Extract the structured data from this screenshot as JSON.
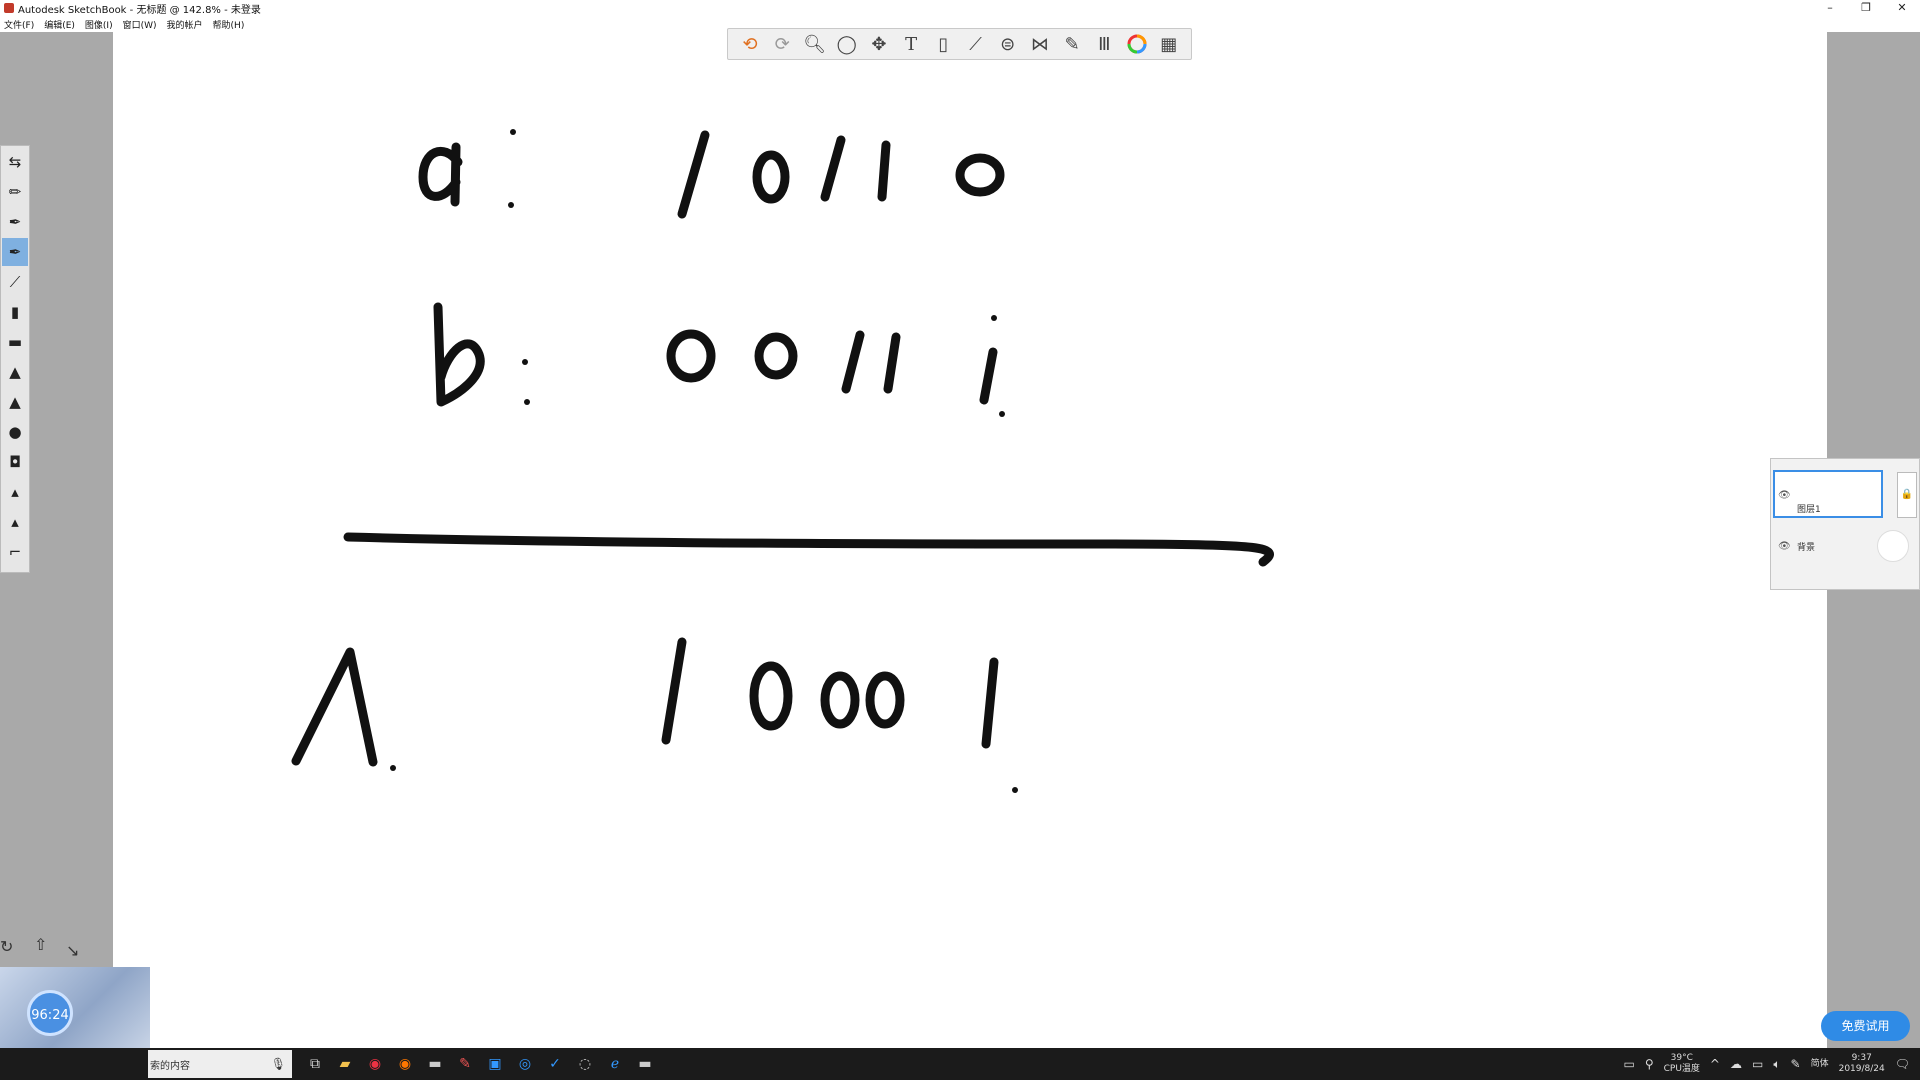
{
  "window": {
    "title": "Autodesk SketchBook - 无标题 @ 142.8% - 未登录",
    "controls": [
      "–",
      "❐",
      "✕"
    ]
  },
  "menu": [
    "文件(F)",
    "编辑(E)",
    "图像(I)",
    "窗口(W)",
    "我的帐户",
    "帮助(H)"
  ],
  "toolbar": {
    "icons": [
      "undo-icon",
      "redo-icon",
      "zoom-icon",
      "lasso-icon",
      "move-icon",
      "text-icon",
      "fill-icon",
      "ruler-icon",
      "ellipse-guide-icon",
      "symmetry-icon",
      "stroke-icon",
      "brush-library-icon",
      "color-wheel-icon",
      "copic-icon"
    ]
  },
  "canvas": {
    "drawing": {
      "row_a": {
        "label": "a:",
        "digits": "10110"
      },
      "row_b": {
        "label": "b:",
        "digits": "00111"
      },
      "row_result": {
        "label": "∧",
        "digits": "10001"
      }
    }
  },
  "layers": {
    "layer1": "图层1",
    "background": "背景",
    "eye_glyph": "👁",
    "lock_glyph": "🔒"
  },
  "webcam": {
    "timer": "96:24"
  },
  "trial_button": "免费试用",
  "taskbar": {
    "search_placeholder": "索的内容",
    "cpu_temp": "39°C",
    "cpu_label": "CPU温度",
    "ime": "简体",
    "time": "9:37",
    "date": "2019/8/24"
  }
}
